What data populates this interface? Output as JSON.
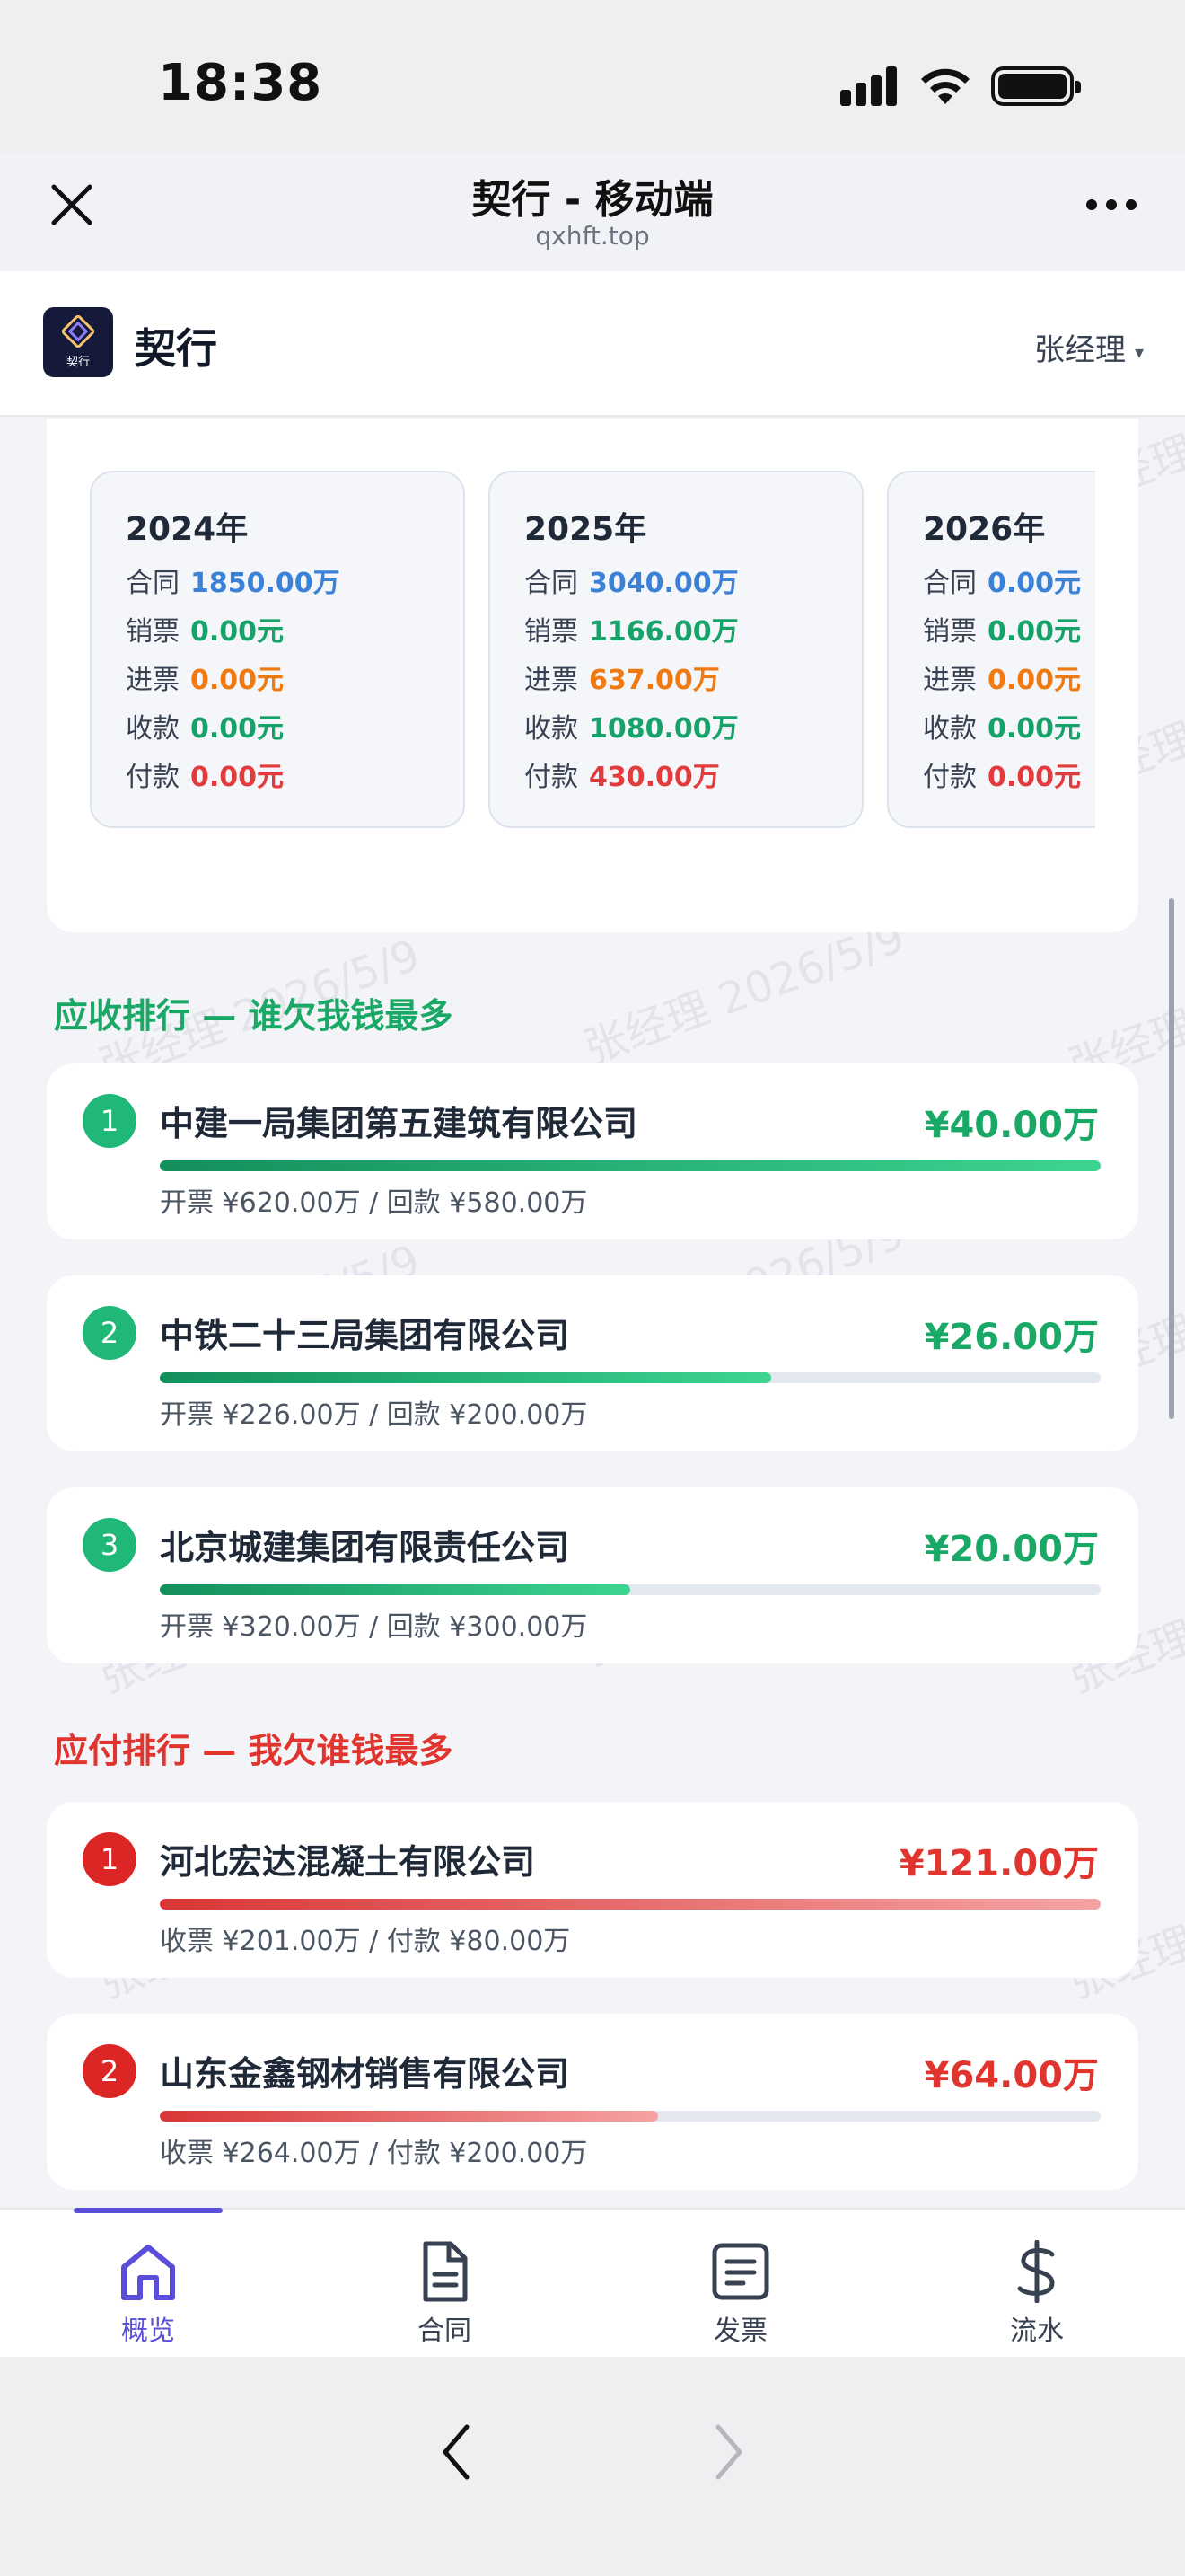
{
  "status_bar": {
    "time": "18:38"
  },
  "browser": {
    "title": "契行 - 移动端",
    "url": "qxhft.top"
  },
  "app": {
    "logo_text": "契行",
    "name": "契行",
    "user": "张经理",
    "user_caret": "▾"
  },
  "watermark": "张经理 2026/5/9",
  "year_cards": [
    {
      "year": "2024年",
      "rows": [
        {
          "label": "合同",
          "value": "1850.00万",
          "color": "blue"
        },
        {
          "label": "销票",
          "value": "0.00元",
          "color": "green"
        },
        {
          "label": "进票",
          "value": "0.00元",
          "color": "orange"
        },
        {
          "label": "收款",
          "value": "0.00元",
          "color": "green"
        },
        {
          "label": "付款",
          "value": "0.00元",
          "color": "red"
        }
      ]
    },
    {
      "year": "2025年",
      "rows": [
        {
          "label": "合同",
          "value": "3040.00万",
          "color": "blue"
        },
        {
          "label": "销票",
          "value": "1166.00万",
          "color": "green"
        },
        {
          "label": "进票",
          "value": "637.00万",
          "color": "orange"
        },
        {
          "label": "收款",
          "value": "1080.00万",
          "color": "green"
        },
        {
          "label": "付款",
          "value": "430.00万",
          "color": "red"
        }
      ]
    },
    {
      "year": "2026年",
      "rows": [
        {
          "label": "合同",
          "value": "0.00元",
          "color": "blue"
        },
        {
          "label": "销票",
          "value": "0.00元",
          "color": "green"
        },
        {
          "label": "进票",
          "value": "0.00元",
          "color": "orange"
        },
        {
          "label": "收款",
          "value": "0.00元",
          "color": "green"
        },
        {
          "label": "付款",
          "value": "0.00元",
          "color": "red"
        }
      ]
    }
  ],
  "receivable": {
    "title": "应收排行 — 谁欠我钱最多",
    "items": [
      {
        "rank": "1",
        "name": "中建一局集团第五建筑有限公司",
        "amount": "¥40.00万",
        "detail": "开票 ¥620.00万 / 回款 ¥580.00万",
        "progress": 1.0
      },
      {
        "rank": "2",
        "name": "中铁二十三局集团有限公司",
        "amount": "¥26.00万",
        "detail": "开票 ¥226.00万 / 回款 ¥200.00万",
        "progress": 0.65
      },
      {
        "rank": "3",
        "name": "北京城建集团有限责任公司",
        "amount": "¥20.00万",
        "detail": "开票 ¥320.00万 / 回款 ¥300.00万",
        "progress": 0.5
      }
    ]
  },
  "payable": {
    "title": "应付排行 — 我欠谁钱最多",
    "items": [
      {
        "rank": "1",
        "name": "河北宏达混凝土有限公司",
        "amount": "¥121.00万",
        "detail": "收票 ¥201.00万 / 付款 ¥80.00万",
        "progress": 1.0
      },
      {
        "rank": "2",
        "name": "山东金鑫钢材销售有限公司",
        "amount": "¥64.00万",
        "detail": "收票 ¥264.00万 / 付款 ¥200.00万",
        "progress": 0.53
      }
    ]
  },
  "bottom_nav": [
    {
      "label": "概览",
      "icon": "home-icon",
      "active": true
    },
    {
      "label": "合同",
      "icon": "document-icon",
      "active": false
    },
    {
      "label": "发票",
      "icon": "invoice-icon",
      "active": false
    },
    {
      "label": "流水",
      "icon": "dollar-icon",
      "active": false
    }
  ],
  "colors": {
    "accent": "#5b4fd9",
    "receivable": "#1aa866",
    "payable": "#e0342f"
  }
}
